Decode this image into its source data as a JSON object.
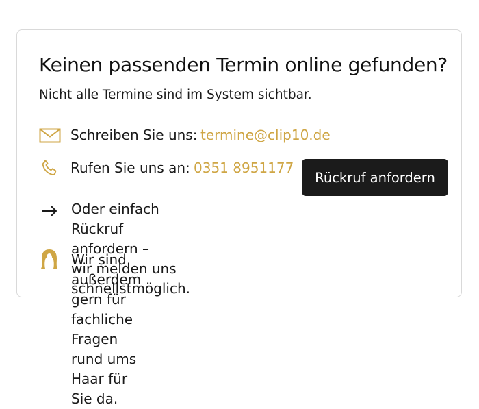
{
  "card": {
    "title": "Keinen passenden Termin online gefunden?",
    "subtitle": "Nicht alle Termine sind im System sichtbar.",
    "email": {
      "icon": "envelope-icon",
      "label": "Schreiben Sie uns:",
      "value": "termine@clip10.de"
    },
    "phone": {
      "icon": "phone-icon",
      "label": "Rufen Sie uns an:",
      "value": "0351 8951177"
    },
    "callback_button": "Rückruf anfordern",
    "callback_note": {
      "icon": "arrow-right-icon",
      "line1": "Oder einfach Rückruf anfordern –",
      "line2": "wir melden uns schnellstmöglich."
    },
    "hair_note": {
      "icon": "hair-woman-icon",
      "line1": "Wir sind außerdem gern für fachliche Fragen rund ums",
      "line2": "Haar für Sie da."
    }
  },
  "colors": {
    "accent": "#cfa645",
    "button_bg": "#1b1b1b",
    "text": "#1a1a1a",
    "border": "#d9d9d9"
  }
}
